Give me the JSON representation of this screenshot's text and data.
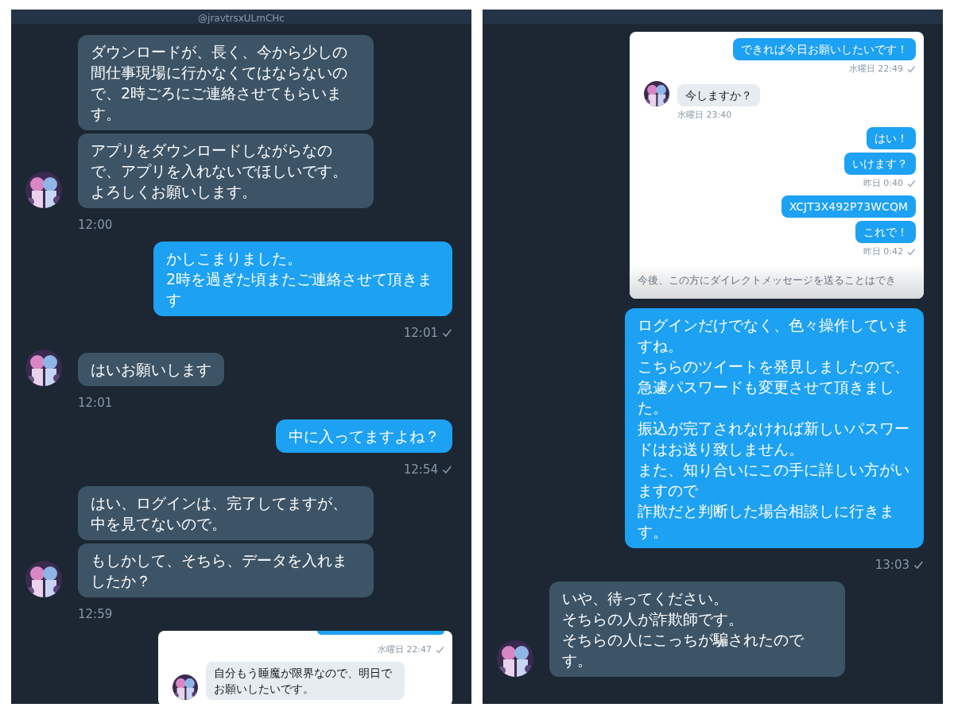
{
  "panels": [
    {
      "header": "@jravtrsxULmCHc",
      "messages": [
        {
          "kind": "in",
          "bubbles": [
            [
              "ダウンロードが、長く、今から少しの間仕事現場に行かなくてはならないので、2時ごろにご連絡させてもらいます。"
            ],
            [
              "アプリをダウンロードしながらなので、アプリを入れないでほしいです。",
              "よろしくお願いします。"
            ]
          ],
          "time": "12:00"
        },
        {
          "kind": "out",
          "bubbles": [
            [
              "かしこまりました。",
              "2時を過ぎた頃またご連絡させて頂きます"
            ]
          ],
          "time": "12:01"
        },
        {
          "kind": "in",
          "bubbles": [
            [
              "はいお願いします"
            ]
          ],
          "time": "12:01"
        },
        {
          "kind": "out",
          "bubbles": [
            [
              "中に入ってますよね？"
            ]
          ],
          "time": "12:54"
        },
        {
          "kind": "in",
          "bubbles": [
            [
              "はい、ログインは、完了してますが、中を見てないので。"
            ],
            [
              "もしかして、そちら、データを入れましたか？"
            ]
          ],
          "time": "12:59"
        },
        {
          "kind": "embed",
          "top_stub": true,
          "messages": [
            {
              "kind": "out",
              "time": "水曜日 22:47"
            },
            {
              "kind": "in",
              "bubbles": [
                [
                  "自分もう睡魔が限界なので、明日でお願いしたいです。"
                ]
              ]
            }
          ]
        }
      ]
    },
    {
      "messages": [
        {
          "kind": "embed",
          "top_stub": false,
          "messages": [
            {
              "kind": "out",
              "bubbles": [
                [
                  "できれば今日お願いしたいです！"
                ]
              ],
              "time": "水曜日 22:49"
            },
            {
              "kind": "in",
              "bubbles": [
                [
                  "今しますか？"
                ]
              ],
              "time": "水曜日 23:40"
            },
            {
              "kind": "out",
              "bubbles": [
                [
                  "はい！"
                ],
                [
                  "いけます？"
                ]
              ],
              "time": "昨日 0:40"
            },
            {
              "kind": "out",
              "bubbles": [
                [
                  "XCJT3X492P73WCQM"
                ],
                [
                  "これで！"
                ]
              ],
              "time": "昨日 0:42"
            }
          ],
          "notice": "今後、この方にダイレクトメッセージを送ることはでき"
        },
        {
          "kind": "out",
          "bubbles": [
            [
              "ログインだけでなく、色々操作していますね。",
              "こちらのツイートを発見しましたので、",
              "急遽パスワードも変更させて頂きました。",
              "振込が完了されなければ新しいパスワードはお送り致しません。",
              "また、知り合いにこの手に詳しい方がいますので",
              "詐欺だと判断した場合相談しに行きます。"
            ]
          ],
          "time": "13:03"
        },
        {
          "kind": "in",
          "bubbles": [
            [
              "いや、待ってください。",
              "そちらの人が詐欺師です。",
              "そちらの人にこっちが騙されたのです。"
            ]
          ]
        }
      ]
    }
  ]
}
